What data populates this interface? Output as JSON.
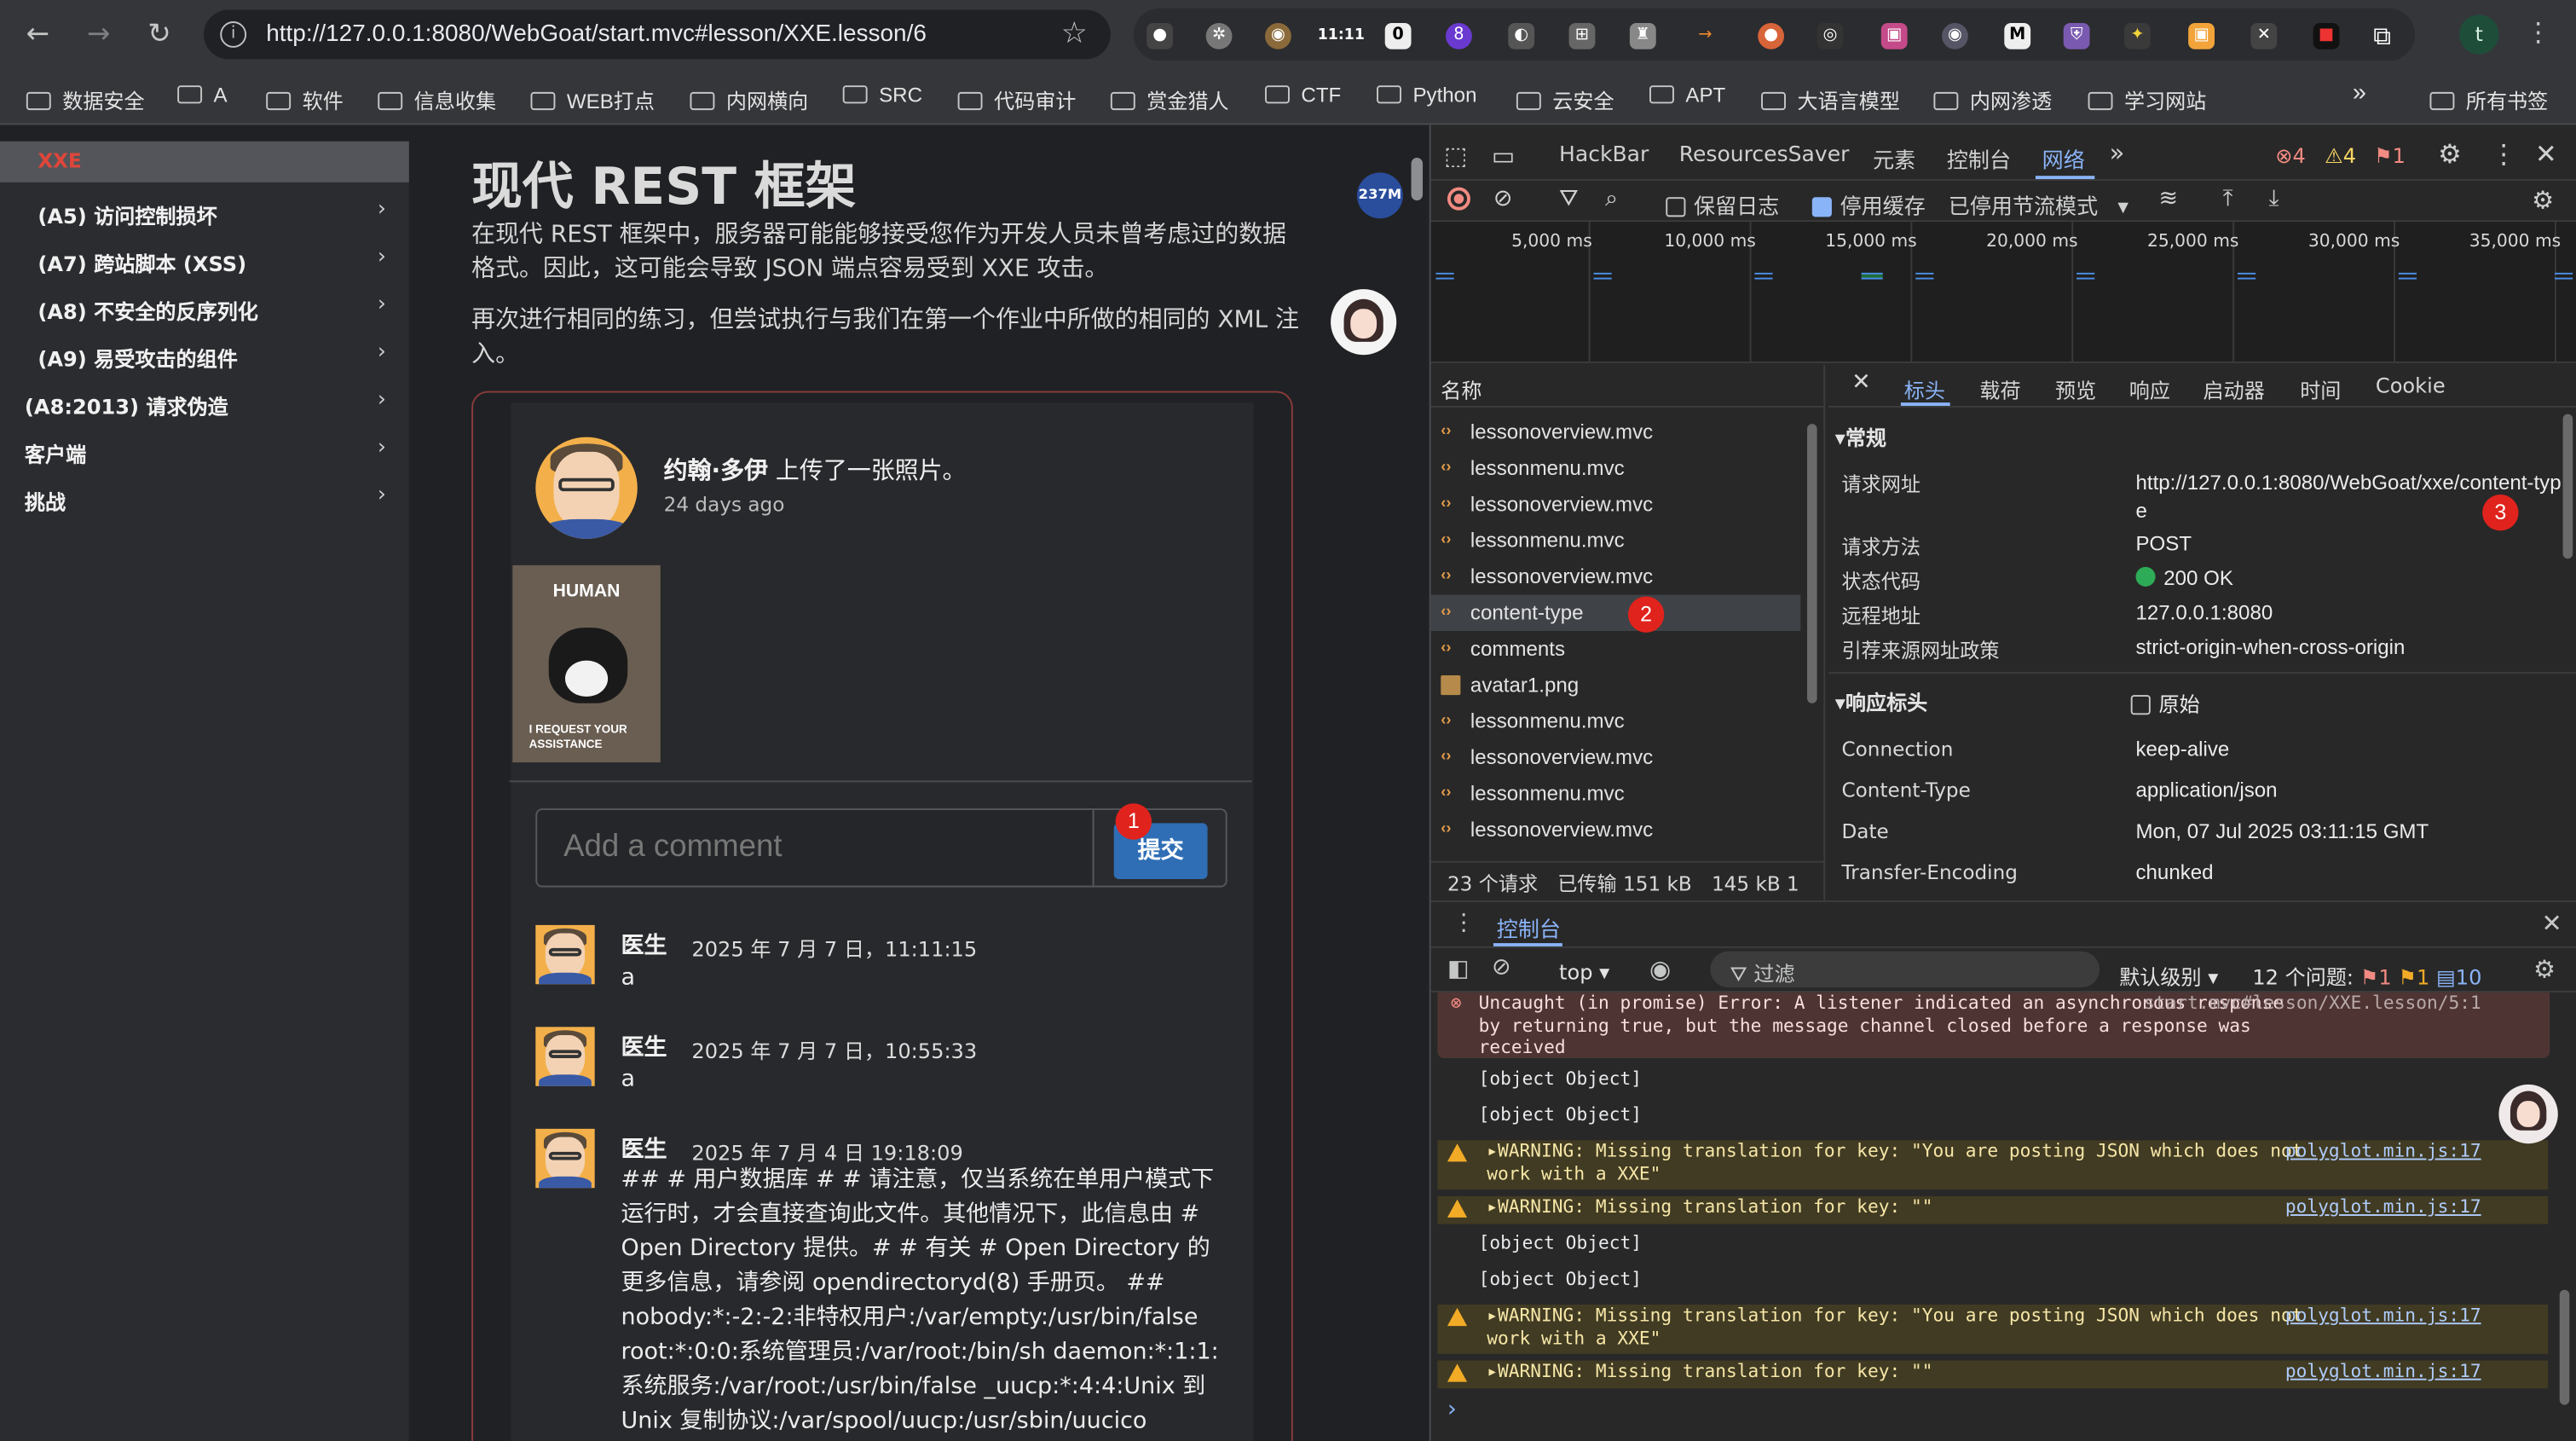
{
  "browser": {
    "url": "http://127.0.0.1:8080/WebGoat/start.mvc#lesson/XXE.lesson/6",
    "ext_clock": "11:11",
    "ext_badge_count": "8",
    "ext_badge_o": "0",
    "profile_letter": "t"
  },
  "bookmarks": [
    {
      "label": "数据安全"
    },
    {
      "label": "A"
    },
    {
      "label": "软件"
    },
    {
      "label": "信息收集"
    },
    {
      "label": "WEB打点"
    },
    {
      "label": "内网横向"
    },
    {
      "label": "SRC"
    },
    {
      "label": "代码审计"
    },
    {
      "label": "赏金猎人"
    },
    {
      "label": "CTF"
    },
    {
      "label": "Python"
    },
    {
      "label": "云安全"
    },
    {
      "label": "APT"
    },
    {
      "label": "大语言模型"
    },
    {
      "label": "内网渗透"
    },
    {
      "label": "学习网站"
    }
  ],
  "bookmarks_more": "»",
  "bookmarks_all": "所有书签",
  "sidebar": {
    "current": "XXE",
    "items": [
      {
        "label": "(A5) 访问控制损坏"
      },
      {
        "label": "(A7) 跨站脚本 (XSS)"
      },
      {
        "label": "(A8) 不安全的反序列化"
      },
      {
        "label": "(A9) 易受攻击的组件"
      },
      {
        "label": "(A8:2013) 请求伪造"
      },
      {
        "label": "客户端"
      },
      {
        "label": "挑战"
      }
    ]
  },
  "lesson": {
    "title": "现代 REST 框架",
    "para1": "在现代 REST 框架中，服务器可能能够接受您作为开发人员未曾考虑过的数据格式。因此，这可能会导致 JSON 端点容易受到 XXE 攻击。",
    "para2": "再次进行相同的练习，但尝试执行与我们在第一个作业中所做的相同的 XML 注入。",
    "poster_name": "约翰·多伊",
    "poster_action": "上传了一张照片。",
    "poster_time": "24 days ago",
    "image_top_text": "HUMAN",
    "image_bottom_text": "I REQUEST YOUR ASSISTANCE",
    "comment_placeholder": "Add a comment",
    "submit_label": "提交",
    "comments": [
      {
        "author": "医生",
        "time": "2025 年 7 月 7 日，11:11:15",
        "text": "a"
      },
      {
        "author": "医生",
        "time": "2025 年 7 月 7 日，10:55:33",
        "text": "a"
      },
      {
        "author": "医生",
        "time": "2025 年 7 月 4 日 19:18:09",
        "text": "## # 用户数据库 # # 请注意，仅当系统在单用户模式下运行时，才会直接查询此文件。其他情况下，此信息由 # Open Directory 提供。# # 有关 # Open Directory 的更多信息，请参阅 opendirectoryd(8) 手册页。 ## nobody:*:-2:-2:非特权用户:/var/empty:/usr/bin/false root:*:0:0:系统管理员:/var/root:/bin/sh daemon:*:1:1:系统服务:/var/root:/usr/bin/false _uucp:*:4:4:Unix 到 Unix 复制协议:/var/spool/uucp:/usr/sbin/uucico"
      }
    ]
  },
  "annotations": {
    "one": "1",
    "two": "2",
    "three": "3"
  },
  "ram_badge": "237M",
  "devtools": {
    "tabs": [
      "HackBar",
      "ResourcesSaver",
      "元素",
      "控制台",
      "网络"
    ],
    "more": "»",
    "errors": "4",
    "warnings": "4",
    "issues": "1",
    "preserve_log": "保留日志",
    "disable_cache": "停用缓存",
    "throttle": "已停用节流模式",
    "timeline_labels": [
      "5,000 ms",
      "10,000 ms",
      "15,000 ms",
      "20,000 ms",
      "25,000 ms",
      "30,000 ms",
      "35,000 ms"
    ],
    "name_header": "名称",
    "requests": [
      {
        "name": "lessonoverview.mvc",
        "type": "doc"
      },
      {
        "name": "lessonmenu.mvc",
        "type": "doc"
      },
      {
        "name": "lessonoverview.mvc",
        "type": "doc"
      },
      {
        "name": "lessonmenu.mvc",
        "type": "doc"
      },
      {
        "name": "lessonoverview.mvc",
        "type": "doc"
      },
      {
        "name": "content-type",
        "type": "doc",
        "selected": true
      },
      {
        "name": "comments",
        "type": "doc"
      },
      {
        "name": "avatar1.png",
        "type": "img"
      },
      {
        "name": "lessonmenu.mvc",
        "type": "doc"
      },
      {
        "name": "lessonoverview.mvc",
        "type": "doc"
      },
      {
        "name": "lessonmenu.mvc",
        "type": "doc"
      },
      {
        "name": "lessonoverview.mvc",
        "type": "doc"
      }
    ],
    "footer": {
      "count": "23 个请求",
      "transferred": "已传输 151 kB",
      "resources": "145 kB 1"
    },
    "detail_tabs": [
      "标头",
      "载荷",
      "预览",
      "响应",
      "启动器",
      "时间",
      "Cookie"
    ],
    "general_title": "常规",
    "general": [
      {
        "k": "请求网址",
        "v": "http://127.0.0.1:8080/WebGoat/xxe/content-type"
      },
      {
        "k": "请求方法",
        "v": "POST"
      },
      {
        "k": "状态代码",
        "v": "200 OK"
      },
      {
        "k": "远程地址",
        "v": "127.0.0.1:8080"
      },
      {
        "k": "引荐来源网址政策",
        "v": "strict-origin-when-cross-origin"
      }
    ],
    "resp_title": "响应标头",
    "raw_label": "原始",
    "resp_headers": [
      {
        "k": "Connection",
        "v": "keep-alive"
      },
      {
        "k": "Content-Type",
        "v": "application/json"
      },
      {
        "k": "Date",
        "v": "Mon, 07 Jul 2025 03:11:15 GMT"
      },
      {
        "k": "Transfer-Encoding",
        "v": "chunked"
      }
    ],
    "console": {
      "title": "控制台",
      "context": "top",
      "filter": "过滤",
      "level": "默认级别",
      "issues_label": "12 个问题:",
      "issue_err": "1",
      "issue_warn": "1",
      "issue_info": "10",
      "error_msg": "Uncaught (in promise) Error: A listener indicated an asynchronous response by returning true, but the message channel closed before a response was received",
      "error_src": "start.mvc#lesson/XXE.lesson/5:1",
      "obj": "[object Object]",
      "warn1": "WARNING: Missing translation for key: \"You are posting JSON which does not work with a XXE\"",
      "warn2": "WARNING: Missing translation for key: \"\"",
      "warn_src": "polyglot.min.js:17",
      "prompt": "›"
    }
  }
}
